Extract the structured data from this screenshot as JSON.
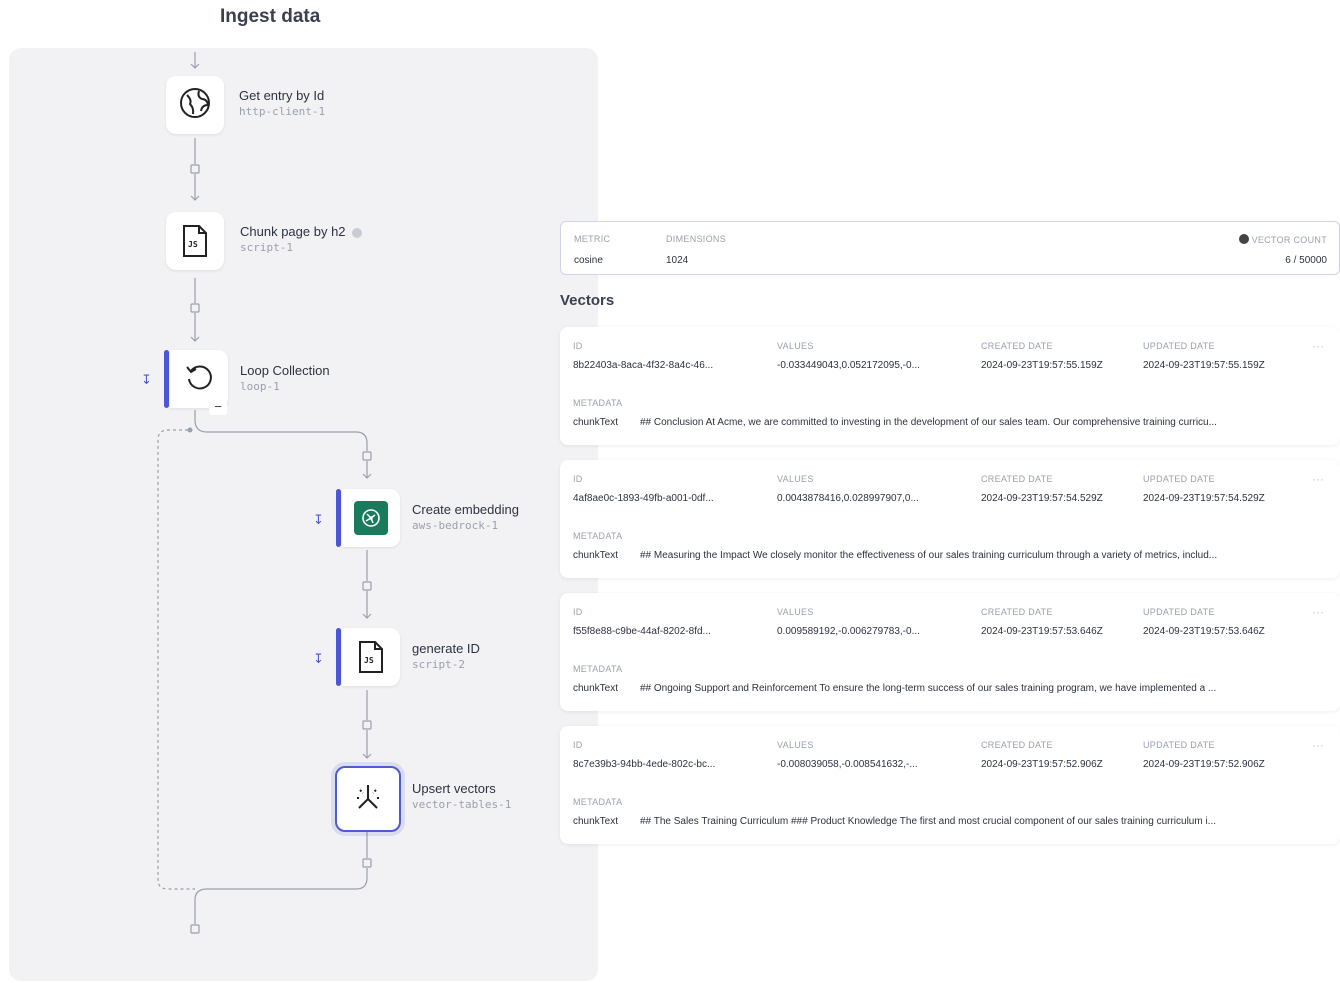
{
  "page_title": "Ingest data",
  "flow": {
    "nodes": [
      {
        "title": "Get entry by Id",
        "id": "http-client-1",
        "icon": "globe-icon"
      },
      {
        "title": "Chunk page by h2",
        "id": "script-1",
        "icon": "js-file-icon"
      },
      {
        "title": "Loop Collection",
        "id": "loop-1",
        "icon": "loop-icon"
      },
      {
        "title": "Create embedding",
        "id": "aws-bedrock-1",
        "icon": "aws-bedrock-icon"
      },
      {
        "title": "generate ID",
        "id": "script-2",
        "icon": "js-file-icon"
      },
      {
        "title": "Upsert vectors",
        "id": "vector-tables-1",
        "icon": "vector-icon"
      }
    ],
    "file_badge": "JS",
    "collapse_symbol": "−"
  },
  "index": {
    "metric_label": "METRIC",
    "metric_value": "cosine",
    "dimensions_label": "DIMENSIONS",
    "dimensions_value": "1024",
    "vector_count_label": "VECTOR COUNT",
    "vector_count_value": "6 / 50000"
  },
  "vectors_heading": "Vectors",
  "vector_labels": {
    "id": "ID",
    "values": "VALUES",
    "created": "CREATED DATE",
    "updated": "UPDATED DATE",
    "metadata": "METADATA",
    "meta_key": "chunkText"
  },
  "vectors": [
    {
      "id": "8b22403a-8aca-4f32-8a4c-46...",
      "values": "-0.033449043,0.052172095,-0...",
      "created": "2024-09-23T19:57:55.159Z",
      "updated": "2024-09-23T19:57:55.159Z",
      "chunk_text": "## Conclusion At Acme, we are committed to investing in the development of our sales team. Our comprehensive training curricu..."
    },
    {
      "id": "4af8ae0c-1893-49fb-a001-0df...",
      "values": "0.0043878416,0.028997907,0...",
      "created": "2024-09-23T19:57:54.529Z",
      "updated": "2024-09-23T19:57:54.529Z",
      "chunk_text": "## Measuring the Impact We closely monitor the effectiveness of our sales training curriculum through a variety of metrics, includ..."
    },
    {
      "id": "f55f8e88-c9be-44af-8202-8fd...",
      "values": "0.009589192,-0.006279783,-0...",
      "created": "2024-09-23T19:57:53.646Z",
      "updated": "2024-09-23T19:57:53.646Z",
      "chunk_text": "## Ongoing Support and Reinforcement To ensure the long-term success of our sales training program, we have implemented a ..."
    },
    {
      "id": "8c7e39b3-94bb-4ede-802c-bc...",
      "values": "-0.008039058,-0.008541632,-...",
      "created": "2024-09-23T19:57:52.906Z",
      "updated": "2024-09-23T19:57:52.906Z",
      "chunk_text": "## The Sales Training Curriculum ### Product Knowledge The first and most crucial component of our sales training curriculum i..."
    }
  ]
}
